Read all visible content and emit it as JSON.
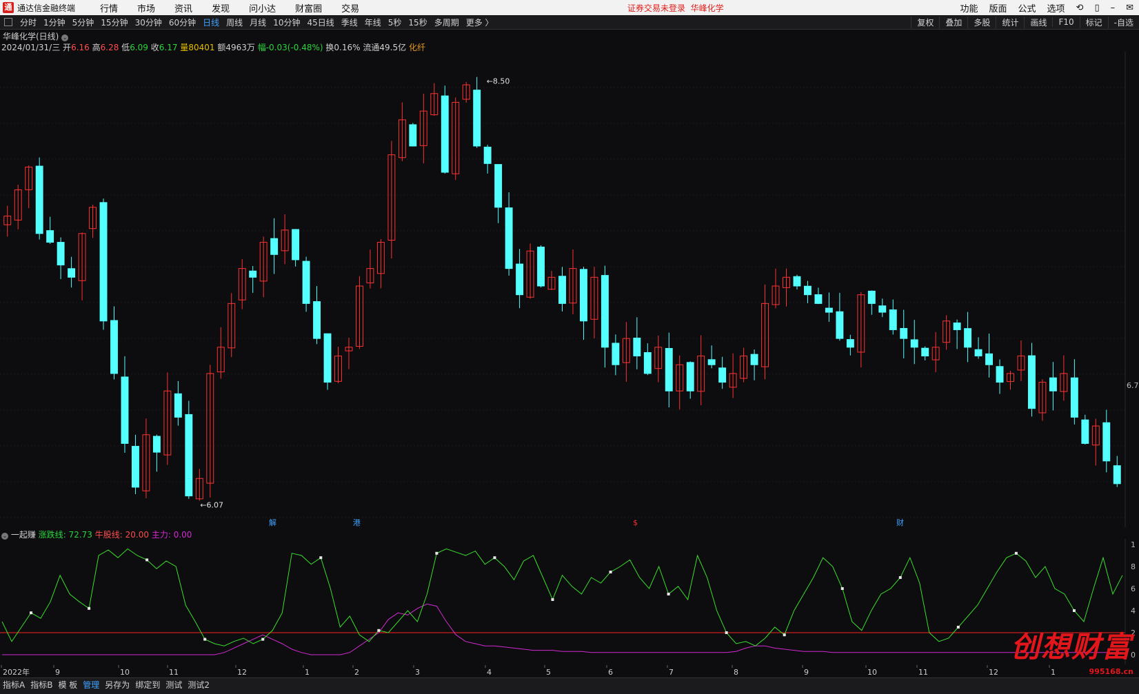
{
  "app": {
    "name": "通达信金融终端",
    "menus": [
      "行情",
      "市场",
      "资讯",
      "发现",
      "问小达",
      "财富圈",
      "交易"
    ],
    "notice": "证券交易未登录",
    "stock_name_top": "华峰化学",
    "right_menus": [
      "功能",
      "版面",
      "公式",
      "选项"
    ]
  },
  "toolbar": {
    "periods": [
      "分时",
      "1分钟",
      "5分钟",
      "15分钟",
      "30分钟",
      "60分钟",
      "日线",
      "周线",
      "月线",
      "10分钟",
      "45日线",
      "季线",
      "年线",
      "5秒",
      "15秒",
      "多周期",
      "更多 〉"
    ],
    "active": "日线",
    "right": [
      "复权",
      "叠加",
      "多股",
      "统计",
      "画线",
      "F10",
      "标记",
      "-自选"
    ]
  },
  "stock": {
    "title": "华峰化学(日线)",
    "date": "2024/01/31/三",
    "open_label": "开",
    "open": "6.16",
    "high_label": "高",
    "high": "6.28",
    "low_label": "低",
    "low": "6.09",
    "close_label": "收",
    "close": "6.17",
    "vol_label": "量",
    "vol": "80401",
    "amount": "额4963万",
    "change_label": "幅",
    "change": "-0.03(-0.48%)",
    "turnover": "换0.16%",
    "float": "流通49.5亿",
    "sector": "化纤"
  },
  "chart_data": [
    {
      "type": "candlestick",
      "title": "华峰化学(日线)",
      "price_max_label": "8.50",
      "price_min_label": "6.07",
      "right_axis_label": "6.7",
      "markers": [
        {
          "text": "解",
          "color": "#3ea2ff"
        },
        {
          "text": "港",
          "color": "#3ea2ff"
        },
        {
          "text": "$",
          "color": "#ff3030"
        },
        {
          "text": "财",
          "color": "#3ea2ff"
        }
      ],
      "closes": [
        7.7,
        7.85,
        7.98,
        7.6,
        7.55,
        7.42,
        7.35,
        7.6,
        7.75,
        7.1,
        6.8,
        6.4,
        6.15,
        6.45,
        6.35,
        6.7,
        6.55,
        6.1,
        6.2,
        6.8,
        6.95,
        7.2,
        7.4,
        7.35,
        7.55,
        7.48,
        7.62,
        7.45,
        7.2,
        7.0,
        6.75,
        6.9,
        6.95,
        7.3,
        7.4,
        7.55,
        8.05,
        8.25,
        8.1,
        8.3,
        8.4,
        7.95,
        8.35,
        8.45,
        8.1,
        8.0,
        7.75,
        7.4,
        7.25,
        7.5,
        7.3,
        7.35,
        7.2,
        7.4,
        7.1,
        7.35,
        6.95,
        6.85,
        7.0,
        6.9,
        6.8,
        6.95,
        6.7,
        6.85,
        6.7,
        6.9,
        6.85,
        6.75,
        6.8,
        6.9,
        6.85,
        7.2,
        7.3,
        7.35,
        7.3,
        7.25,
        7.2,
        7.15,
        7.0,
        6.95,
        7.25,
        7.2,
        7.15,
        7.05,
        7.0,
        6.95,
        6.9,
        6.95,
        7.1,
        7.05,
        6.95,
        6.9,
        6.85,
        6.75,
        6.8,
        6.9,
        6.6,
        6.75,
        6.7,
        6.8,
        6.55,
        6.4,
        6.5,
        6.3,
        6.17
      ],
      "indicator": {
        "name": "一起赚",
        "series": [
          {
            "name": "涨跌线",
            "value": "72.73",
            "color": "#29d63b"
          },
          {
            "name": "牛股线",
            "value": "20.00",
            "color": "#ff3030"
          },
          {
            "name": "主力",
            "value": "0.00",
            "color": "#d42ad4"
          }
        ],
        "ylim": [
          0,
          100
        ],
        "green": [
          30,
          12,
          25,
          38,
          33,
          48,
          72,
          55,
          48,
          42,
          90,
          95,
          88,
          96,
          90,
          86,
          78,
          85,
          80,
          45,
          30,
          14,
          10,
          8,
          12,
          15,
          10,
          14,
          22,
          38,
          92,
          90,
          82,
          88,
          60,
          25,
          35,
          18,
          12,
          22,
          20,
          30,
          40,
          30,
          55,
          92,
          96,
          93,
          90,
          94,
          82,
          88,
          80,
          68,
          85,
          90,
          70,
          50,
          72,
          62,
          55,
          70,
          65,
          75,
          80,
          86,
          70,
          60,
          80,
          55,
          62,
          50,
          90,
          70,
          40,
          20,
          10,
          12,
          8,
          15,
          25,
          18,
          40,
          55,
          70,
          88,
          80,
          60,
          30,
          22,
          40,
          55,
          60,
          70,
          88,
          65,
          20,
          12,
          15,
          25,
          35,
          45,
          60,
          75,
          88,
          92,
          85,
          70,
          80,
          60,
          55,
          40,
          30,
          60,
          88,
          55,
          72
        ],
        "purple": [
          0,
          0,
          0,
          0,
          0,
          0,
          0,
          0,
          0,
          0,
          0,
          0,
          0,
          0,
          0,
          0,
          0,
          0,
          0,
          0,
          0,
          0,
          0,
          2,
          6,
          10,
          14,
          18,
          14,
          10,
          5,
          2,
          0,
          0,
          0,
          0,
          2,
          8,
          14,
          20,
          32,
          38,
          36,
          42,
          46,
          44,
          30,
          18,
          12,
          10,
          8,
          8,
          7,
          6,
          5,
          4,
          4,
          4,
          3,
          3,
          3,
          2,
          2,
          2,
          2,
          2,
          2,
          2,
          2,
          2,
          2,
          2,
          2,
          2,
          2,
          2,
          3,
          6,
          8,
          8,
          6,
          5,
          4,
          3,
          3,
          3,
          2,
          2,
          2,
          2,
          2,
          2,
          2,
          2,
          2,
          2,
          2,
          2,
          2,
          2,
          2,
          2,
          2,
          2,
          2,
          2,
          2,
          2,
          2,
          2,
          2,
          2,
          2,
          2,
          2,
          2,
          2
        ],
        "level": 20
      },
      "x_labels": [
        "2022年",
        "9",
        "10",
        "11",
        "12",
        "1",
        "2",
        "3",
        "4",
        "5",
        "6",
        "7",
        "8",
        "9",
        "10",
        "11",
        "12",
        "1"
      ],
      "right_ticks": [
        "1",
        "8",
        "6",
        "4",
        "2",
        "0"
      ]
    }
  ],
  "bottom_tabs": [
    "指标A",
    "指标B",
    "模 板",
    "管理",
    "另存为",
    "绑定到",
    "测试",
    "测试2"
  ],
  "bottom_active": "管理",
  "watermark": {
    "text": "创想财富",
    "url": "995168.cn"
  }
}
